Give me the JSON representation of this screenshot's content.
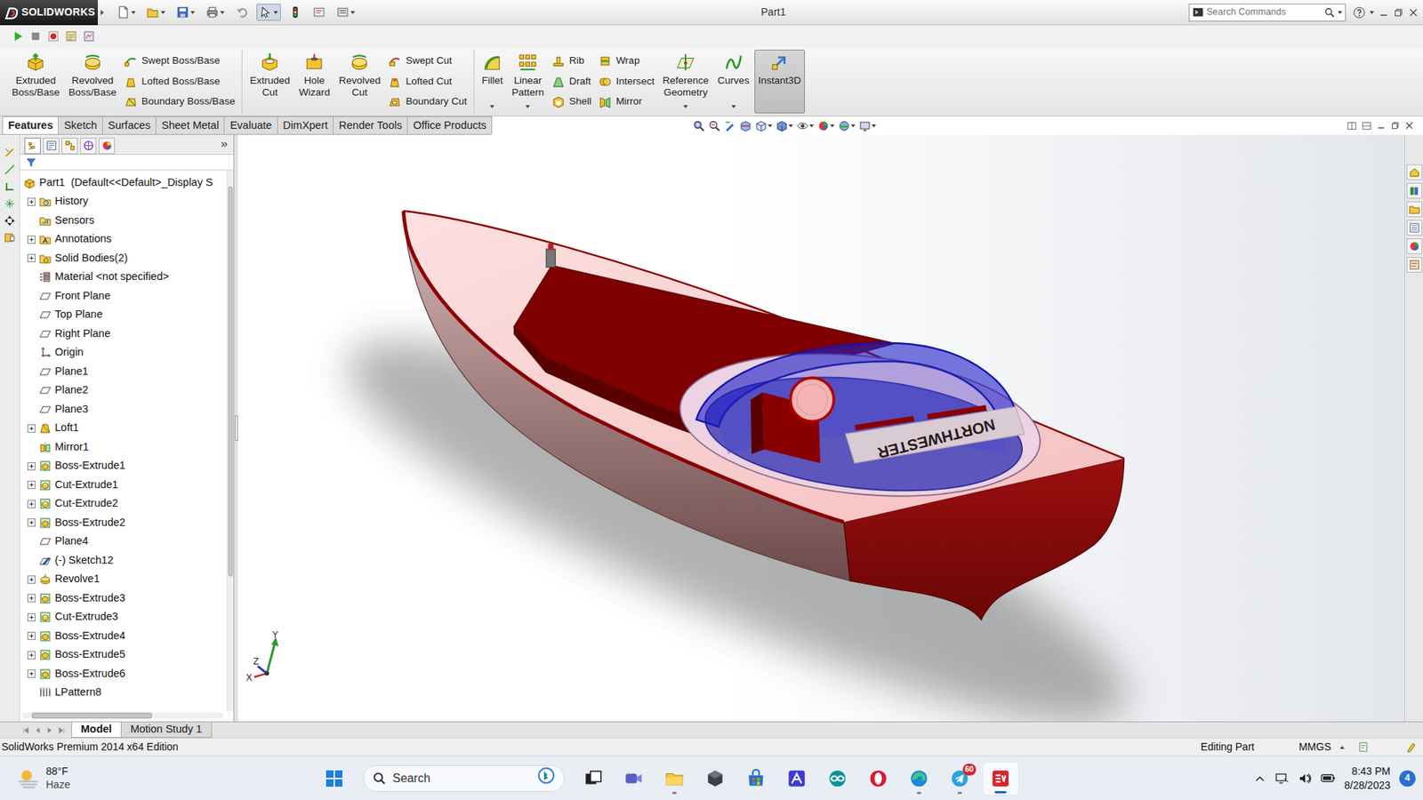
{
  "window": {
    "logo": "SOLIDWORKS",
    "title": "Part1"
  },
  "search": {
    "placeholder": "Search Commands"
  },
  "ribbon": [
    {
      "items": [
        {
          "kind": "large",
          "label": "Extruded Boss/Base",
          "dropdown": false,
          "selected": false
        },
        {
          "kind": "large",
          "label": "Revolved Boss/Base",
          "dropdown": false,
          "selected": false
        },
        {
          "kind": "column",
          "entries": [
            "Swept Boss/Base",
            "Lofted Boss/Base",
            "Boundary Boss/Base"
          ]
        }
      ]
    },
    {
      "items": [
        {
          "kind": "large",
          "label": "Extruded Cut",
          "dropdown": false,
          "selected": false
        },
        {
          "kind": "large",
          "label": "Hole Wizard",
          "dropdown": false,
          "selected": false
        },
        {
          "kind": "large",
          "label": "Revolved Cut",
          "dropdown": false,
          "selected": false
        },
        {
          "kind": "column",
          "entries": [
            "Swept Cut",
            "Lofted Cut",
            "Boundary Cut"
          ]
        }
      ]
    },
    {
      "items": [
        {
          "kind": "large",
          "label": "Fillet",
          "dropdown": true,
          "selected": false
        },
        {
          "kind": "large",
          "label": "Linear Pattern",
          "dropdown": true,
          "selected": false
        },
        {
          "kind": "column",
          "entries": [
            "Rib",
            "Draft",
            "Shell"
          ]
        },
        {
          "kind": "column",
          "entries": [
            "Wrap",
            "Intersect",
            "Mirror"
          ]
        },
        {
          "kind": "large",
          "label": "Reference Geometry",
          "dropdown": true,
          "selected": false
        },
        {
          "kind": "large",
          "label": "Curves",
          "dropdown": true,
          "selected": false
        },
        {
          "kind": "large",
          "label": "Instant3D",
          "dropdown": false,
          "selected": true
        }
      ]
    }
  ],
  "tabs": [
    {
      "label": "Features",
      "selected": true
    },
    {
      "label": "Sketch",
      "selected": false
    },
    {
      "label": "Surfaces",
      "selected": false
    },
    {
      "label": "Sheet Metal",
      "selected": false
    },
    {
      "label": "Evaluate",
      "selected": false
    },
    {
      "label": "DimXpert",
      "selected": false
    },
    {
      "label": "Render Tools",
      "selected": false
    },
    {
      "label": "Office Products",
      "selected": false
    }
  ],
  "panel_tabs": [
    {
      "kind": "feature",
      "selected": true
    },
    {
      "kind": "property",
      "selected": false
    },
    {
      "kind": "config",
      "selected": false
    },
    {
      "kind": "dimxpert",
      "selected": false
    },
    {
      "kind": "display",
      "selected": false
    }
  ],
  "tree": [
    {
      "label": "Part1  (Default<<Default>_Display S",
      "kind": "part",
      "expandable": false
    },
    {
      "label": "History",
      "kind": "history",
      "expandable": true
    },
    {
      "label": "Sensors",
      "kind": "sensor",
      "expandable": false
    },
    {
      "label": "Annotations",
      "kind": "annotation",
      "expandable": true
    },
    {
      "label": "Solid Bodies(2)",
      "kind": "bodies",
      "expandable": true
    },
    {
      "label": "Material <not specified>",
      "kind": "material",
      "expandable": false
    },
    {
      "label": "Front Plane",
      "kind": "plane",
      "expandable": false
    },
    {
      "label": "Top Plane",
      "kind": "plane",
      "expandable": false
    },
    {
      "label": "Right Plane",
      "kind": "plane",
      "expandable": false
    },
    {
      "label": "Origin",
      "kind": "origin",
      "expandable": false
    },
    {
      "label": "Plane1",
      "kind": "plane",
      "expandable": false
    },
    {
      "label": "Plane2",
      "kind": "plane",
      "expandable": false
    },
    {
      "label": "Plane3",
      "kind": "plane",
      "expandable": false
    },
    {
      "label": "Loft1",
      "kind": "loft",
      "expandable": true
    },
    {
      "label": "Mirror1",
      "kind": "mirror",
      "expandable": false
    },
    {
      "label": "Boss-Extrude1",
      "kind": "extrude",
      "expandable": true
    },
    {
      "label": "Cut-Extrude1",
      "kind": "cut",
      "expandable": true
    },
    {
      "label": "Cut-Extrude2",
      "kind": "cut",
      "expandable": true
    },
    {
      "label": "Boss-Extrude2",
      "kind": "extrude",
      "expandable": true
    },
    {
      "label": "Plane4",
      "kind": "plane",
      "expandable": false
    },
    {
      "label": "(-) Sketch12",
      "kind": "sketch",
      "expandable": false
    },
    {
      "label": "Revolve1",
      "kind": "revolve",
      "expandable": true
    },
    {
      "label": "Boss-Extrude3",
      "kind": "extrude",
      "expandable": true
    },
    {
      "label": "Cut-Extrude3",
      "kind": "cut",
      "expandable": true
    },
    {
      "label": "Boss-Extrude4",
      "kind": "extrude",
      "expandable": true
    },
    {
      "label": "Boss-Extrude5",
      "kind": "extrude",
      "expandable": true
    },
    {
      "label": "Boss-Extrude6",
      "kind": "extrude",
      "expandable": true
    },
    {
      "label": "LPattern8",
      "kind": "pattern",
      "expandable": false
    }
  ],
  "tree_scroll": {
    "vertical": 0.72,
    "horizontal": 0.6
  },
  "viewport": {
    "model_label": "NORTHWESTER",
    "triad": {
      "x": "X",
      "y": "Y",
      "z": "Z"
    }
  },
  "model_tabs": [
    {
      "label": "Model",
      "selected": true
    },
    {
      "label": "Motion Study 1",
      "selected": false
    }
  ],
  "status_bar": {
    "edition": "SolidWorks Premium 2014 x64 Edition",
    "mode": "Editing Part",
    "units": "MMGS"
  },
  "taskbar": {
    "weather": {
      "temp": "88°F",
      "condition": "Haze"
    },
    "search": "Search",
    "apps": [
      {
        "kind": "taskview",
        "running": false,
        "active": false
      },
      {
        "kind": "meet",
        "running": false,
        "active": false
      },
      {
        "kind": "explorer",
        "running": true,
        "active": false
      },
      {
        "kind": "cube",
        "running": false,
        "active": false
      },
      {
        "kind": "store",
        "running": false,
        "active": false
      },
      {
        "kind": "editor",
        "running": false,
        "active": false
      },
      {
        "kind": "arduino",
        "running": false,
        "active": false
      },
      {
        "kind": "opera",
        "running": false,
        "active": false
      },
      {
        "kind": "edge",
        "running": true,
        "active": false
      },
      {
        "kind": "telegram",
        "running": true,
        "active": false,
        "badge": "60"
      },
      {
        "kind": "solidworks",
        "running": true,
        "active": true
      }
    ],
    "time": "8:43 PM",
    "date": "8/28/2023",
    "notifications": "4"
  }
}
